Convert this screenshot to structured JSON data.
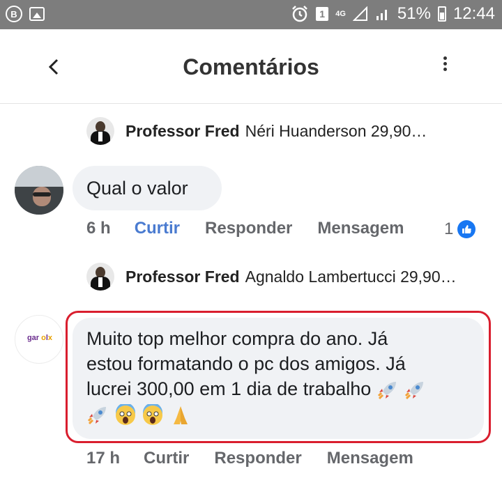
{
  "status_bar": {
    "left_icons": [
      "b-circle-icon",
      "image-icon"
    ],
    "b_label": "B",
    "sim_label": "1",
    "network_top": "4G",
    "battery": "51%",
    "time": "12:44"
  },
  "header": {
    "title": "Comentários",
    "back_icon": "chevron-left-icon",
    "menu_icon": "kebab-menu-icon"
  },
  "thread": [
    {
      "reply_preview": {
        "author": "Professor Fred",
        "text": "Néri Huanderson 29,90…"
      },
      "comment": {
        "text": "Qual o valor",
        "time": "6 h",
        "like_label": "Curtir",
        "reply_label": "Responder",
        "message_label": "Mensagem",
        "reaction_count": "1",
        "reaction_icon": "like-icon"
      }
    },
    {
      "reply_preview": {
        "author": "Professor Fred",
        "text": "Agnaldo Lambertucci 29,90…"
      },
      "comment": {
        "line1": "Muito top melhor compra do ano. Já",
        "line2": "estou formatando o pc dos amigos. Já",
        "line3": "lucrei 300,00 em 1 dia de trabalho",
        "emojis": [
          "rocket",
          "rocket",
          "rocket",
          "scream",
          "scream",
          "folded-hands"
        ],
        "avatar_logo": "gar olx",
        "time": "17 h",
        "like_label": "Curtir",
        "reply_label": "Responder",
        "message_label": "Mensagem"
      }
    }
  ],
  "colors": {
    "status_bar": "#7d7d7d",
    "bubble": "#f0f2f5",
    "like_blue": "#4a7bd0",
    "highlight": "#d91e2e"
  }
}
